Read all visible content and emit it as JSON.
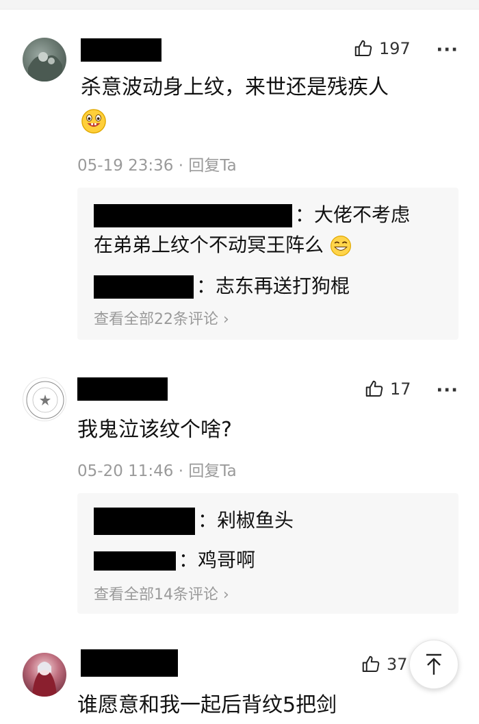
{
  "comments": [
    {
      "likes": "197",
      "content_line1": "杀意波动身上纹，来世还是残疾人",
      "emoji": "grinning-face-emoji",
      "meta": "05-19 23:36 · 回复Ta",
      "replies": [
        {
          "text_a": "：大佬不考虑",
          "text_b": "在弟弟上纹个不动冥王阵么"
        },
        {
          "text": "：志东再送打狗棍"
        }
      ],
      "view_all": "查看全部22条评论 ›"
    },
    {
      "likes": "17",
      "content_line1": "我鬼泣该纹个啥?",
      "meta": "05-20 11:46 · 回复Ta",
      "replies": [
        {
          "text": "：剁椒鱼头"
        },
        {
          "text": "：鸡哥啊"
        }
      ],
      "view_all": "查看全部14条评论 ›"
    },
    {
      "likes": "37",
      "content_line1": "谁愿意和我一起后背纹5把剑"
    }
  ],
  "more_label": "···",
  "icons": {
    "like": "thumbs-up-icon",
    "more": "more-dots-icon",
    "scroll_top": "arrow-up-icon"
  }
}
